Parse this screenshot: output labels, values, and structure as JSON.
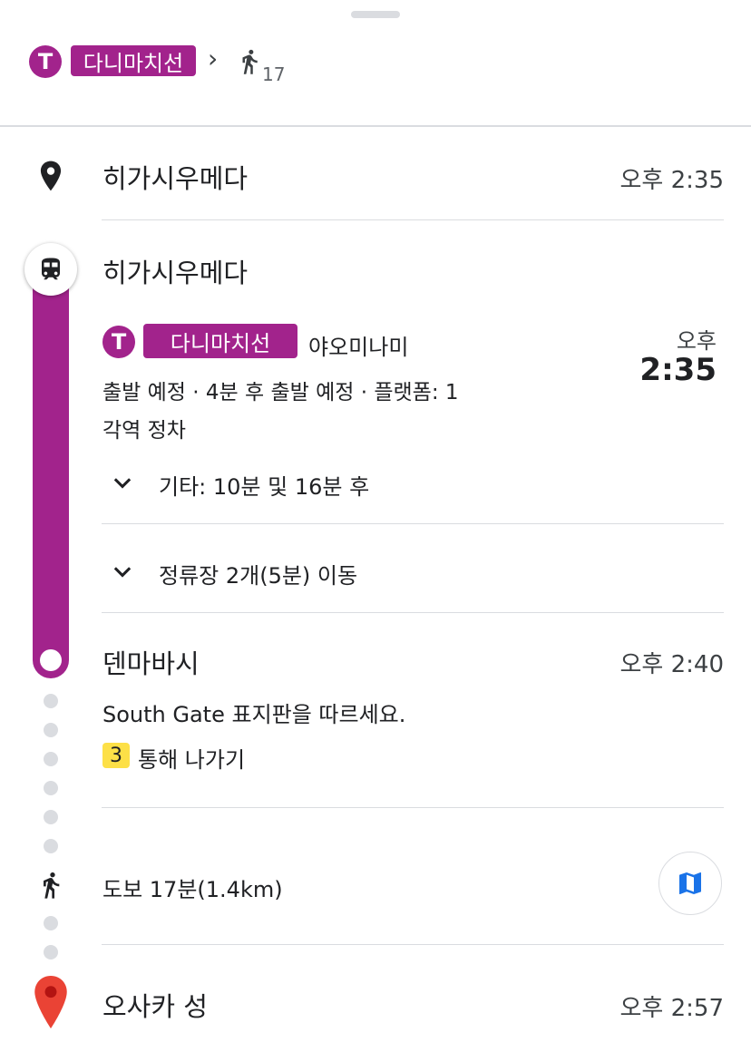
{
  "summary": {
    "line_letter": "T",
    "line_name": "다니마치선",
    "chevron": "›",
    "walk_minutes": "17"
  },
  "origin": {
    "name": "히가시우메다",
    "time": "오후 2:35"
  },
  "transit": {
    "station": "히가시우메다",
    "line_letter": "T",
    "line_name": "다니마치선",
    "direction": "야오미나미",
    "depart_ampm": "오후",
    "depart_time": "2:35",
    "status": "출발 예정 · 4분 후 출발 예정 · 플랫폼: 1",
    "service": "각역 정차",
    "others": "기타: 10분 및 16분 후",
    "stops": "정류장 2개(5분) 이동"
  },
  "arrival": {
    "name": "덴마바시",
    "time": "오후 2:40",
    "instruction": "South Gate 표지판을 따르세요.",
    "exit_number": "3",
    "exit_label": "통해 나가기"
  },
  "walk": {
    "label": "도보 17분(1.4km)"
  },
  "destination": {
    "name": "오사카 성",
    "time": "오후 2:57"
  },
  "colors": {
    "line": "#a2238c",
    "exit_badge": "#fde047",
    "pin": "#ea4335",
    "map_icon": "#1a73e8"
  }
}
